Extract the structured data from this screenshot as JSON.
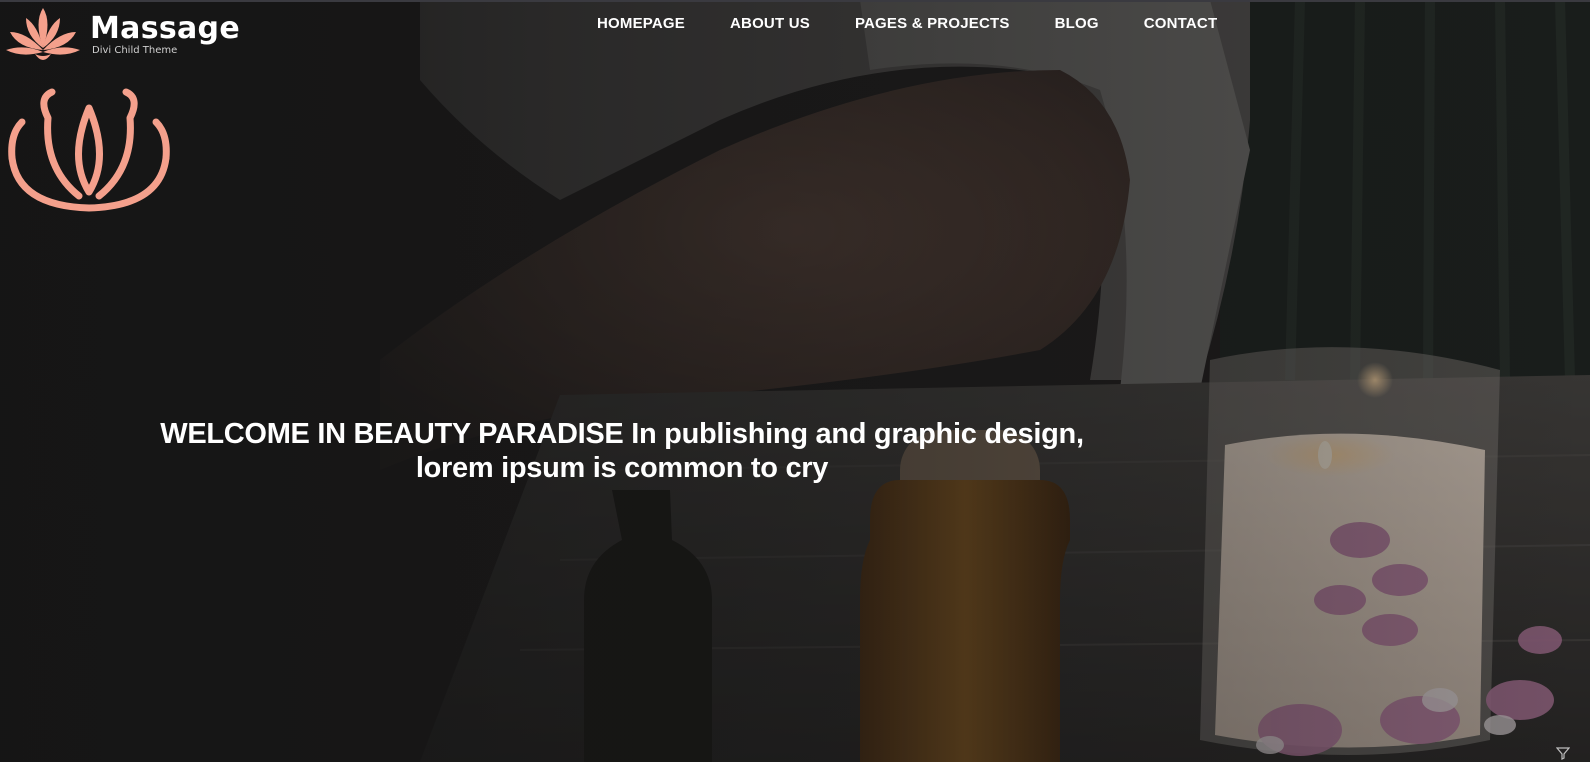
{
  "brand": {
    "name": "Massage",
    "tagline": "Divi Child Theme",
    "logo_icon": "lotus-icon",
    "accent_color": "#f4a08c"
  },
  "nav": {
    "items": [
      {
        "label": "HOMEPAGE"
      },
      {
        "label": "ABOUT US"
      },
      {
        "label": "PAGES & PROJECTS"
      },
      {
        "label": "BLOG"
      },
      {
        "label": "CONTACT"
      }
    ]
  },
  "hero": {
    "decor_icon": "lotus-outline-icon",
    "headline": "WELCOME IN BEAUTY PARADISE In publishing and graphic design, lorem ipsum is common to cry",
    "background": "spa-scene-candle-oil-bottles-flowers"
  }
}
